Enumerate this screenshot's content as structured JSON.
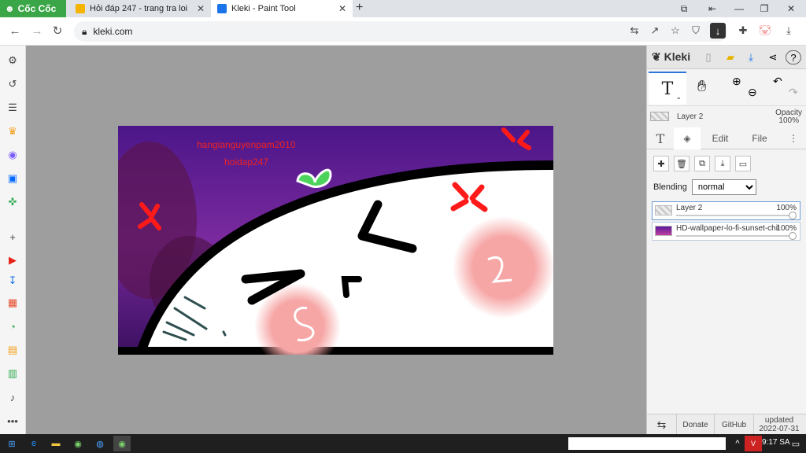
{
  "browser": {
    "brand": "Cốc Cốc",
    "tabs": [
      {
        "title": "Hỏi đáp 247 - trang tra loi",
        "favicon_color": "#f4b400"
      },
      {
        "title": "Kleki - Paint Tool",
        "favicon_color": "#1a73e8"
      }
    ],
    "address": "kleki.com"
  },
  "canvas": {
    "watermark_lines": [
      "hangianguyenpam2010",
      "hoidap247"
    ],
    "colors": {
      "sky": "#5b1a9a",
      "white": "#ffffff",
      "black": "#000000",
      "blush": "#f5a8a8",
      "anger": "#ff1a1a",
      "leaf": "#4bd35b"
    }
  },
  "kleki": {
    "logo": "Kleki",
    "active_tool": "T",
    "layer_name": "Layer 2",
    "opacity_label": "Opacity",
    "opacity_value": "100%",
    "subtabs": {
      "edit": "Edit",
      "file": "File"
    },
    "blending_label": "Blending",
    "blending_value": "normal",
    "layers": [
      {
        "name": "Layer 2",
        "opacity": "100%"
      },
      {
        "name": "HD-wallpaper-lo-fi-sunset-chil",
        "opacity": "100%"
      }
    ],
    "footer": {
      "donate": "Donate",
      "github": "GitHub",
      "updated_label": "updated",
      "updated_date": "2022-07-31"
    }
  },
  "taskbar": {
    "time": "9:17 SA"
  },
  "icons": [
    "settings-icon",
    "history-icon",
    "list-icon",
    "crown-icon",
    "messenger-icon",
    "zalo-icon",
    "gamepad-icon",
    "plus-icon",
    "youtube-icon",
    "download-icon",
    "shop-icon",
    "chat-icon",
    "market-icon",
    "calc-icon",
    "bell-icon",
    "more-icon"
  ]
}
